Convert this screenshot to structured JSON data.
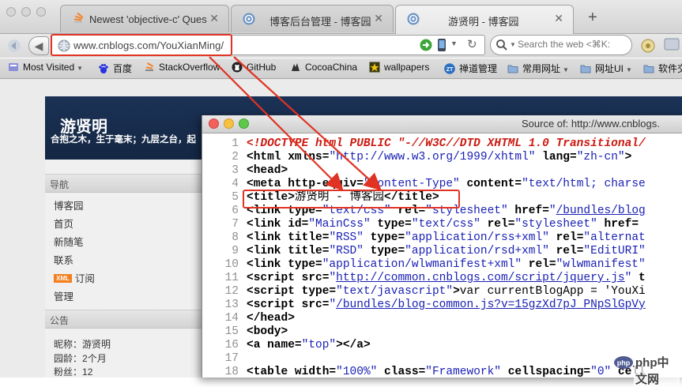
{
  "browser": {
    "tabs": [
      {
        "label": "Newest 'objective-c' Ques",
        "icon": "stackoverflow-icon",
        "close": "✕"
      },
      {
        "label": "博客后台管理 - 博客园",
        "icon": "cnblogs-icon",
        "close": "✕"
      },
      {
        "label": "游贤明 - 博客园",
        "icon": "cnblogs-icon",
        "close": "✕"
      }
    ],
    "new_tab": "+",
    "url": "www.cnblogs.com/YouXianMing/",
    "search_placeholder": "Search the web <⌘K:",
    "bookmarks": [
      {
        "label": "Most Visited",
        "icon": "most-visited-icon",
        "caret": "▼"
      },
      {
        "label": "百度",
        "icon": "baidu-icon"
      },
      {
        "label": "StackOverflow",
        "icon": "stackoverflow-icon"
      },
      {
        "label": "GitHub",
        "icon": "github-icon"
      },
      {
        "label": "CocoaChina",
        "icon": "cocoachina-icon"
      },
      {
        "label": "wallpapers",
        "icon": "wallpapers-icon"
      },
      {
        "label": "禅道管理",
        "icon": "zentao-icon"
      },
      {
        "label": "常用网址",
        "icon": "folder-icon",
        "caret": "▼"
      },
      {
        "label": "网址UI",
        "icon": "folder-icon",
        "caret": "▼"
      },
      {
        "label": "软件交",
        "icon": "folder-icon"
      }
    ]
  },
  "blog": {
    "title": "游贤明",
    "subtitle": "合抱之木，生于毫末；九层之台，起",
    "nav_heading": "导航",
    "nav_items": [
      "博客园",
      "首页",
      "新随笔",
      "联系",
      "订阅",
      "管理"
    ],
    "xml_badge": "XML",
    "notice_heading": "公告",
    "info": [
      {
        "label": "昵称：",
        "value": "游贤明"
      },
      {
        "label": "园龄：",
        "value": "2个月"
      },
      {
        "label": "粉丝：",
        "value": "12"
      }
    ]
  },
  "source": {
    "window_title": "Source of: http://www.cnblogs.",
    "lines": [
      {
        "n": "1",
        "segs": [
          [
            "doc",
            "<!DOCTYPE html PUBLIC \"-//W3C//DTD XHTML 1.0 Transitional/"
          ]
        ]
      },
      {
        "n": "2",
        "segs": [
          [
            "tag",
            "<html "
          ],
          [
            "attr",
            "xmlns="
          ],
          [
            "val",
            "\"http://www.w3.org/1999/xhtml\""
          ],
          [
            "attr",
            " lang="
          ],
          [
            "val",
            "\"zh-cn\""
          ],
          [
            "tag",
            ">"
          ]
        ]
      },
      {
        "n": "3",
        "segs": [
          [
            "tag",
            "<head>"
          ]
        ]
      },
      {
        "n": "4",
        "segs": [
          [
            "tag",
            "<meta "
          ],
          [
            "attr",
            "http-equiv="
          ],
          [
            "val",
            "\"Content-Type\""
          ],
          [
            "attr",
            " content="
          ],
          [
            "val",
            "\"text/html; charse"
          ]
        ]
      },
      {
        "n": "5",
        "segs": [
          [
            "tag",
            "<title>"
          ],
          [
            "text",
            "游贤明 - 博客园"
          ],
          [
            "tag",
            "</title>"
          ]
        ]
      },
      {
        "n": "6",
        "segs": [
          [
            "tag",
            "<link "
          ],
          [
            "attr",
            "type="
          ],
          [
            "val",
            "\"text/css\""
          ],
          [
            "attr",
            " rel="
          ],
          [
            "val",
            "\"stylesheet\""
          ],
          [
            "attr",
            " href="
          ],
          [
            "val",
            "\""
          ],
          [
            "link",
            "/bundles/blog"
          ]
        ]
      },
      {
        "n": "7",
        "segs": [
          [
            "tag",
            "<link "
          ],
          [
            "attr",
            "id="
          ],
          [
            "val",
            "\"MainCss\""
          ],
          [
            "attr",
            " type="
          ],
          [
            "val",
            "\"text/css\""
          ],
          [
            "attr",
            " rel="
          ],
          [
            "val",
            "\"stylesheet\""
          ],
          [
            "attr",
            " href="
          ]
        ]
      },
      {
        "n": "8",
        "segs": [
          [
            "tag",
            "<link "
          ],
          [
            "attr",
            "title="
          ],
          [
            "val",
            "\"RSS\""
          ],
          [
            "attr",
            " type="
          ],
          [
            "val",
            "\"application/rss+xml\""
          ],
          [
            "attr",
            " rel="
          ],
          [
            "val",
            "\"alternat"
          ]
        ]
      },
      {
        "n": "9",
        "segs": [
          [
            "tag",
            "<link "
          ],
          [
            "attr",
            "title="
          ],
          [
            "val",
            "\"RSD\""
          ],
          [
            "attr",
            " type="
          ],
          [
            "val",
            "\"application/rsd+xml\""
          ],
          [
            "attr",
            " rel="
          ],
          [
            "val",
            "\"EditURI\""
          ]
        ]
      },
      {
        "n": "10",
        "segs": [
          [
            "tag",
            "<link "
          ],
          [
            "attr",
            "type="
          ],
          [
            "val",
            "\"application/wlwmanifest+xml\""
          ],
          [
            "attr",
            " rel="
          ],
          [
            "val",
            "\"wlwmanifest\""
          ]
        ]
      },
      {
        "n": "11",
        "segs": [
          [
            "tag",
            "<script "
          ],
          [
            "attr",
            "src="
          ],
          [
            "val",
            "\""
          ],
          [
            "link",
            "http://common.cnblogs.com/script/jquery.js"
          ],
          [
            "val",
            "\""
          ],
          [
            "attr",
            " t"
          ]
        ]
      },
      {
        "n": "12",
        "segs": [
          [
            "tag",
            "<script "
          ],
          [
            "attr",
            "type="
          ],
          [
            "val",
            "\"text/javascript\""
          ],
          [
            "tag",
            ">"
          ],
          [
            "text",
            "var currentBlogApp = 'YouXi"
          ]
        ]
      },
      {
        "n": "13",
        "segs": [
          [
            "tag",
            "<script "
          ],
          [
            "attr",
            "src="
          ],
          [
            "val",
            "\""
          ],
          [
            "link",
            "/bundles/blog-common.js?v=15gzXd7pJ_PNpSlGpVy"
          ]
        ]
      },
      {
        "n": "14",
        "segs": [
          [
            "tag",
            "</head>"
          ]
        ]
      },
      {
        "n": "15",
        "segs": [
          [
            "tag",
            "<body>"
          ]
        ]
      },
      {
        "n": "16",
        "segs": [
          [
            "tag",
            "<a "
          ],
          [
            "attr",
            "name="
          ],
          [
            "val",
            "\"top\""
          ],
          [
            "tag",
            "></a>"
          ]
        ]
      },
      {
        "n": "17",
        "segs": []
      },
      {
        "n": "18",
        "segs": [
          [
            "tag",
            "<table "
          ],
          [
            "attr",
            "width="
          ],
          [
            "val",
            "\"100%\""
          ],
          [
            "attr",
            " class="
          ],
          [
            "val",
            "\"Framework\""
          ],
          [
            "attr",
            " cellspacing="
          ],
          [
            "val",
            "\"0\""
          ],
          [
            "attr",
            " cell"
          ]
        ]
      }
    ]
  },
  "watermark": "php中文网",
  "colors": {
    "annotation_red": "#e03323",
    "blog_header": "#1b3256",
    "source_doctype": "#cc1b12",
    "source_value": "#1a21b5"
  }
}
